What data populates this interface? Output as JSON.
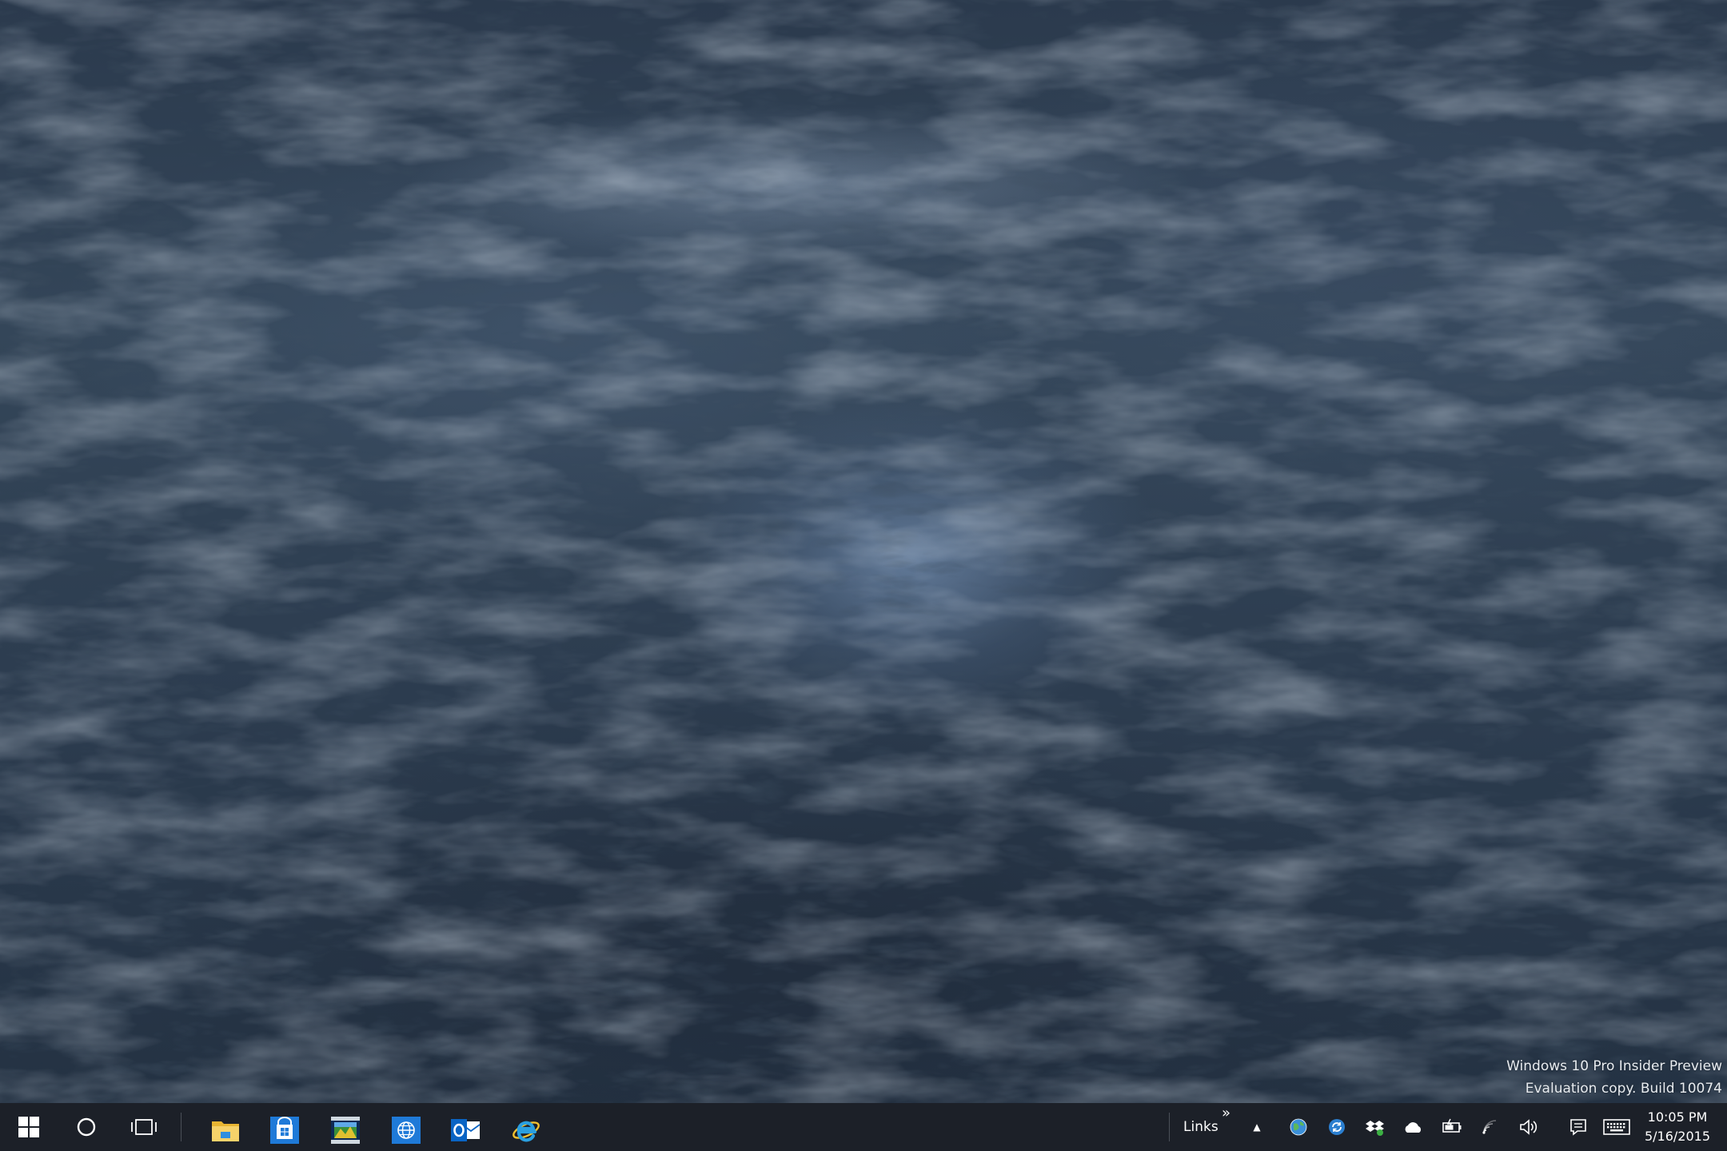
{
  "desktop": {
    "wallpaper": "dark ocean water",
    "watermark": {
      "line1": "Windows 10 Pro Insider Preview",
      "line2": "Evaluation copy. Build 10074"
    }
  },
  "taskbar": {
    "background": "#1c2028",
    "start": {
      "icon": "windows-logo-icon"
    },
    "search": {
      "icon": "cortana-circle-icon"
    },
    "task_view": {
      "icon": "task-view-icon"
    },
    "pinned_apps": [
      {
        "name": "file-explorer",
        "icon": "folder-icon",
        "color": "#f4c542"
      },
      {
        "name": "store",
        "icon": "store-icon",
        "color": "#1f7ad8"
      },
      {
        "name": "media-app",
        "icon": "film-icon",
        "color": "#1a5fb0"
      },
      {
        "name": "web-app",
        "icon": "globe-icon",
        "color": "#1f7ad8"
      },
      {
        "name": "outlook",
        "icon": "outlook-icon",
        "color": "#0a64c4"
      },
      {
        "name": "internet-explorer",
        "icon": "ie-icon",
        "color": "#2a9fe0"
      }
    ],
    "toolbar": {
      "links_label": "Links",
      "overflow_chevron": "»"
    },
    "tray": {
      "show_hidden": "▲",
      "icons": [
        "network-globe-icon",
        "sync-icon",
        "dropbox-icon",
        "onedrive-icon",
        "battery-icon",
        "wifi-icon",
        "volume-icon",
        "action-center-icon",
        "keyboard-icon"
      ]
    },
    "clock": {
      "time": "10:05 PM",
      "date": "5/16/2015"
    }
  }
}
